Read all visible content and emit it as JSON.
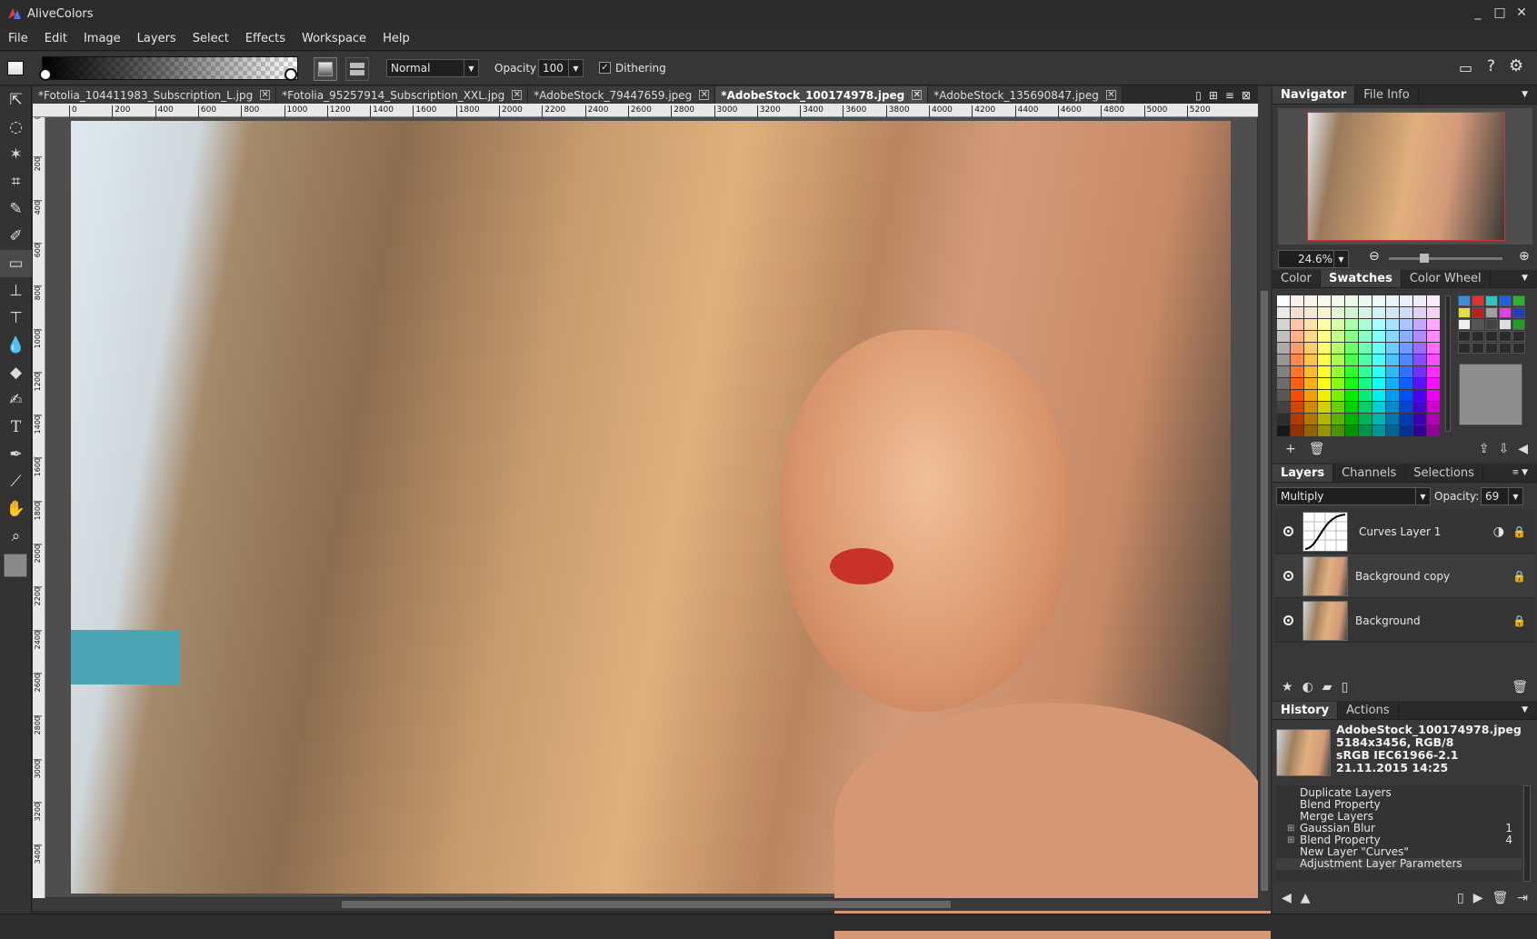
{
  "app": {
    "title": "AliveColors",
    "window_buttons": [
      "_",
      "□",
      "✕"
    ]
  },
  "menu": [
    "File",
    "Edit",
    "Image",
    "Layers",
    "Select",
    "Effects",
    "Workspace",
    "Help"
  ],
  "options": {
    "blend_mode": "Normal",
    "opacity_label": "Opacity",
    "opacity_value": "100",
    "dithering_label": "Dithering",
    "dithering_checked": true
  },
  "tabs": [
    {
      "label": "*Fotolia_104411983_Subscription_L.jpg",
      "active": false
    },
    {
      "label": "*Fotolia_95257914_Subscription_XXL.jpg",
      "active": false
    },
    {
      "label": "*AdobeStock_79447659.jpeg",
      "active": false
    },
    {
      "label": "*AdobeStock_100174978.jpeg",
      "active": true
    },
    {
      "label": "*AdobeStock_135690847.jpeg",
      "active": false
    }
  ],
  "ruler_h": [
    "0",
    "200",
    "400",
    "600",
    "800",
    "1000",
    "1200",
    "1400",
    "1600",
    "1800",
    "2000",
    "2200",
    "2400",
    "2600",
    "2800",
    "3000",
    "3200",
    "3400",
    "3600",
    "3800",
    "4000",
    "4200",
    "4400",
    "4600",
    "4800",
    "5000",
    "5200"
  ],
  "ruler_v": [
    "0",
    "200",
    "400",
    "600",
    "800",
    "1000",
    "1200",
    "1400",
    "1600",
    "1800",
    "2000",
    "2200",
    "2400",
    "2600",
    "2800",
    "3000",
    "3200",
    "3400"
  ],
  "navigator": {
    "tabs": [
      "Navigator",
      "File Info"
    ],
    "zoom": "24.6%"
  },
  "color_panel": {
    "tabs": [
      "Color",
      "Swatches",
      "Color Wheel"
    ],
    "active": "Swatches"
  },
  "layers_panel": {
    "tabs": [
      "Layers",
      "Channels",
      "Selections"
    ],
    "blend_mode": "Multiply",
    "opacity_label": "Opacity:",
    "opacity_value": "69",
    "layers": [
      {
        "name": "Curves Layer 1"
      },
      {
        "name": "Background copy"
      },
      {
        "name": "Background"
      }
    ]
  },
  "history_panel": {
    "tabs": [
      "History",
      "Actions"
    ],
    "file_name": "AdobeStock_100174978.jpeg",
    "file_dims": "5184x3456, RGB/8",
    "file_profile": "sRGB IEC61966-2.1",
    "file_date": "21.11.2015 14:25",
    "items": [
      {
        "label": "Duplicate Layers",
        "count": "",
        "expandable": false
      },
      {
        "label": "Blend Property",
        "count": "",
        "expandable": false
      },
      {
        "label": "Merge Layers",
        "count": "",
        "expandable": false
      },
      {
        "label": "Gaussian Blur",
        "count": "1",
        "expandable": true
      },
      {
        "label": "Blend Property",
        "count": "4",
        "expandable": true
      },
      {
        "label": "New Layer \"Curves\"",
        "count": "",
        "expandable": false
      },
      {
        "label": "Adjustment Layer Parameters",
        "count": "",
        "expandable": false
      }
    ]
  },
  "icons": {
    "tools": [
      "move-icon",
      "lasso-icon",
      "magic-wand-icon",
      "crop-icon",
      "brush-icon",
      "clone-brush-icon",
      "gradient-icon",
      "stamp-icon",
      "stamp-alt-icon",
      "drop-icon",
      "eraser-icon",
      "smudge-icon",
      "text-icon",
      "pen-icon",
      "eyedropper-icon",
      "hand-icon",
      "zoom-icon"
    ]
  }
}
